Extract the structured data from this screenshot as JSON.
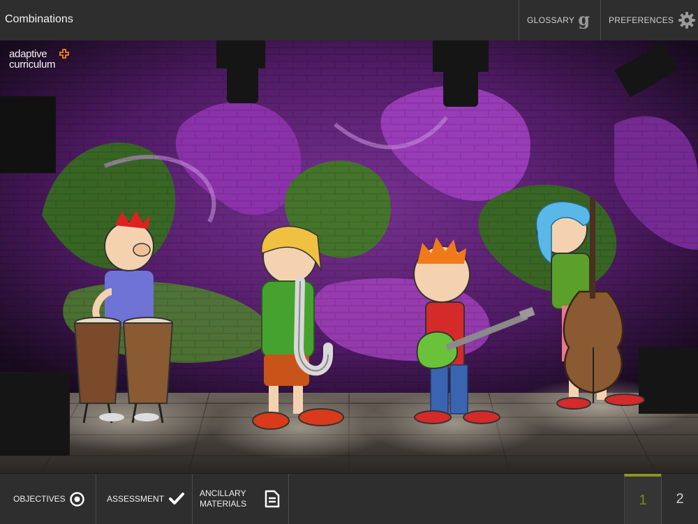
{
  "header": {
    "title": "Combinations",
    "glossary_label": "GLOSSARY",
    "preferences_label": "PREFERENCES",
    "glossary_icon_letter": "g"
  },
  "scene": {
    "logo_line1": "adaptive",
    "logo_line2": "curriculum",
    "colors": {
      "wall_purple": "#7a2a9a",
      "graffiti_green": "#4c8a2c",
      "stage_wood": "#5a5048"
    },
    "characters": [
      "conga-player",
      "saxophone-player",
      "guitar-player",
      "bass-player"
    ]
  },
  "footer": {
    "objectives_label": "OBJECTIVES",
    "assessment_label": "ASSESSMENT",
    "ancillary_label_line1": "ANCILLARY",
    "ancillary_label_line2": "MATERIALS",
    "pages": [
      "1",
      "2"
    ],
    "current_page": "1",
    "accent_color": "#8a9620"
  }
}
